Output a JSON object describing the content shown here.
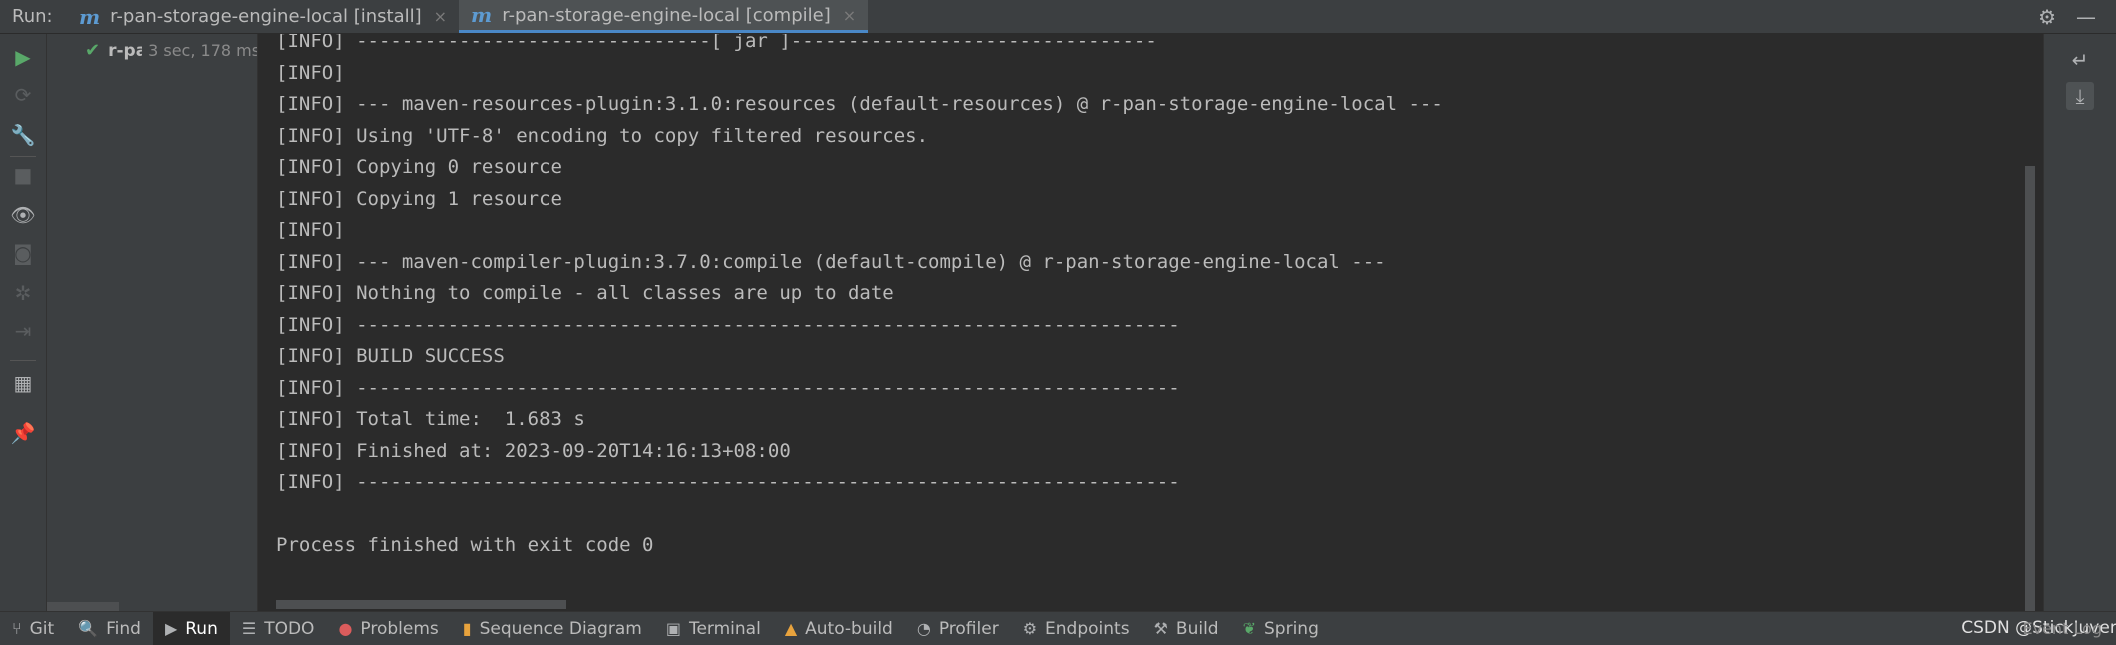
{
  "tabbar": {
    "run_label": "Run:",
    "tabs": [
      {
        "icon": "m",
        "label": "r-pan-storage-engine-local [install]",
        "close": "×"
      },
      {
        "icon": "m",
        "label": "r-pan-storage-engine-local [compile]",
        "close": "×"
      }
    ],
    "settings_icon": "⚙",
    "minimize_icon": "—"
  },
  "tree": {
    "item_name": "r-pan-storage-engine-local",
    "item_time": "3 sec, 178 ms"
  },
  "console": {
    "lines": [
      "[INFO] -------------------------------[ jar ]--------------------------------",
      "[INFO]",
      "[INFO] --- maven-resources-plugin:3.1.0:resources (default-resources) @ r-pan-storage-engine-local ---",
      "[INFO] Using 'UTF-8' encoding to copy filtered resources.",
      "[INFO] Copying 0 resource",
      "[INFO] Copying 1 resource",
      "[INFO]",
      "[INFO] --- maven-compiler-plugin:3.7.0:compile (default-compile) @ r-pan-storage-engine-local ---",
      "[INFO] Nothing to compile - all classes are up to date",
      "[INFO] ------------------------------------------------------------------------",
      "[INFO] BUILD SUCCESS",
      "[INFO] ------------------------------------------------------------------------",
      "[INFO] Total time:  1.683 s",
      "[INFO] Finished at: 2023-09-20T14:16:13+08:00",
      "[INFO] ------------------------------------------------------------------------",
      "",
      "Process finished with exit code 0"
    ]
  },
  "bottombar": {
    "items": [
      {
        "icon": "⑂",
        "label": "Git"
      },
      {
        "icon": "🔍",
        "label": "Find"
      },
      {
        "icon": "▶",
        "label": "Run"
      },
      {
        "icon": "☰",
        "label": "TODO"
      },
      {
        "icon": "●",
        "label": "Problems"
      },
      {
        "icon": "▮",
        "label": "Sequence Diagram"
      },
      {
        "icon": "▣",
        "label": "Terminal"
      },
      {
        "icon": "▲",
        "label": "Auto-build"
      },
      {
        "icon": "◔",
        "label": "Profiler"
      },
      {
        "icon": "⚙",
        "label": "Endpoints"
      },
      {
        "icon": "⚒",
        "label": "Build"
      },
      {
        "icon": "❦",
        "label": "Spring"
      }
    ],
    "event_log": "Event Log",
    "watermark": "CSDN @StickJuvenile"
  }
}
